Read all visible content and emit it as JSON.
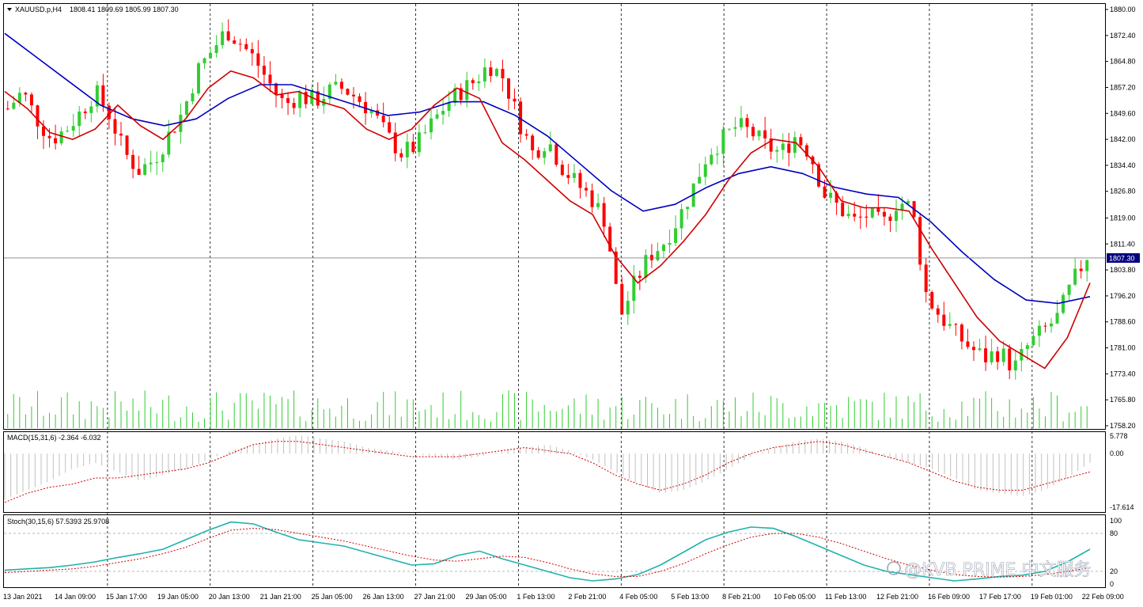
{
  "window": {
    "symbol_title": "XAUUSD.p,H4",
    "ohlc_text": "1808.41 1809.69 1805.99 1807.30",
    "macd_title": "MACD(15,31,6) -2.364 -6.032",
    "stoch_title": "Stoch(30,15,6) 57.5393 25.9708",
    "watermark": "@KVB PRIME 中文服务",
    "current_price_label": "1807.30",
    "menu_icon": "triangle-down-icon",
    "watermark_icon": "weibo-style-logo-icon"
  },
  "colors": {
    "bull": "#32cd32",
    "bear": "#ff0000",
    "ma_fast": "#d00000",
    "ma_slow": "#0000c0",
    "stoch_main": "#20b2aa",
    "signal": "#d00000",
    "grid": "#000000",
    "hist": "#c0c0c0"
  },
  "chart_data": [
    {
      "type": "candlestick",
      "title": "XAUUSD.p,H4",
      "ylim": [
        1758.2,
        1880.0
      ],
      "yticks": [
        "1880.00",
        "1872.40",
        "1864.80",
        "1857.20",
        "1849.60",
        "1842.00",
        "1834.40",
        "1826.80",
        "1819.00",
        "1811.40",
        "1803.80",
        "1796.20",
        "1788.60",
        "1781.00",
        "1773.40",
        "1765.80",
        "1758.20"
      ],
      "xticks": [
        "13 Jan 2021",
        "14 Jan 09:00",
        "15 Jan 17:00",
        "19 Jan 05:00",
        "20 Jan 13:00",
        "21 Jan 21:00",
        "25 Jan 05:00",
        "26 Jan 13:00",
        "27 Jan 21:00",
        "29 Jan 05:00",
        "1 Feb 13:00",
        "2 Feb 21:00",
        "4 Feb 05:00",
        "5 Feb 13:00",
        "8 Feb 21:00",
        "10 Feb 05:00",
        "11 Feb 13:00",
        "12 Feb 21:00",
        "16 Feb 09:00",
        "17 Feb 17:00",
        "19 Feb 01:00",
        "22 Feb 09:00"
      ],
      "close_path": [
        1851,
        1856,
        1848,
        1842,
        1845,
        1850,
        1856,
        1849,
        1838,
        1833,
        1836,
        1843,
        1850,
        1862,
        1868,
        1874,
        1870,
        1865,
        1858,
        1852,
        1855,
        1853,
        1856,
        1857,
        1854,
        1850,
        1843,
        1838,
        1840,
        1846,
        1852,
        1856,
        1859,
        1864,
        1860,
        1848,
        1838,
        1842,
        1834,
        1829,
        1825,
        1818,
        1790,
        1800,
        1808,
        1812,
        1819,
        1828,
        1838,
        1842,
        1846,
        1844,
        1840,
        1838,
        1843,
        1838,
        1826,
        1822,
        1818,
        1820,
        1817,
        1824,
        1822,
        1796,
        1790,
        1785,
        1781,
        1778,
        1780,
        1775,
        1782,
        1786,
        1790,
        1800,
        1808
      ],
      "last_price": 1807.3,
      "series": [
        {
          "name": "Moving Average (fast)",
          "values": [
            1856,
            1851,
            1844,
            1842,
            1845,
            1852,
            1846,
            1842,
            1848,
            1857,
            1862,
            1860,
            1855,
            1856,
            1853,
            1851,
            1845,
            1842,
            1845,
            1852,
            1857,
            1854,
            1841,
            1836,
            1830,
            1824,
            1820,
            1808,
            1800,
            1805,
            1812,
            1820,
            1830,
            1838,
            1842,
            1841,
            1834,
            1824,
            1822,
            1822,
            1821,
            1810,
            1800,
            1790,
            1783,
            1779,
            1775,
            1784,
            1800
          ]
        },
        {
          "name": "Moving Average (slow)",
          "values": [
            1873,
            1866,
            1859,
            1852,
            1848,
            1846,
            1848,
            1854,
            1858,
            1858,
            1855,
            1852,
            1849,
            1850,
            1853,
            1853,
            1849,
            1843,
            1835,
            1827,
            1821,
            1823,
            1828,
            1832,
            1834,
            1832,
            1828,
            1826,
            1825,
            1818,
            1809,
            1801,
            1795,
            1794,
            1796
          ]
        }
      ],
      "has_volume_histogram": true,
      "current_price_line": true
    },
    {
      "type": "macd",
      "title": "MACD(15,31,6)",
      "ylim": [
        -17.614,
        5.778
      ],
      "yticks": [
        "5.778",
        "0.00",
        "-17.614"
      ],
      "macd_value": -2.364,
      "signal_value": -6.032,
      "histogram": [
        -15,
        -12,
        -9,
        -5,
        -3,
        -6,
        -9,
        -7,
        -5,
        -2,
        1,
        3,
        5,
        6,
        5,
        4,
        2,
        1,
        0,
        -1,
        -2,
        -1,
        1,
        2,
        3,
        1,
        -2,
        -6,
        -10,
        -13,
        -12,
        -9,
        -5,
        -1,
        2,
        4,
        5,
        4,
        2,
        -1,
        -3,
        -5,
        -8,
        -12,
        -13,
        -14,
        -12,
        -8,
        -3
      ],
      "signal": [
        -16,
        -13,
        -11,
        -10,
        -8,
        -8,
        -7,
        -6,
        -5,
        -3,
        0,
        3,
        4,
        4,
        3,
        2,
        1,
        0,
        -1,
        -1,
        -1,
        0,
        1,
        2,
        1,
        0,
        -3,
        -7,
        -10,
        -12,
        -10,
        -7,
        -3,
        0,
        2,
        3,
        4,
        3,
        1,
        -1,
        -3,
        -6,
        -9,
        -11,
        -12,
        -12,
        -10,
        -8,
        -6
      ]
    },
    {
      "type": "stochastic",
      "title": "Stoch(30,15,6)",
      "ylim": [
        0,
        100
      ],
      "yticks": [
        "100",
        "80",
        "20",
        "0"
      ],
      "levels": [
        80,
        20
      ],
      "main_value": 57.5393,
      "signal_value": 25.9708,
      "main": [
        22,
        24,
        26,
        30,
        35,
        42,
        48,
        55,
        70,
        85,
        98,
        95,
        82,
        70,
        65,
        60,
        50,
        40,
        30,
        32,
        45,
        52,
        40,
        30,
        20,
        10,
        5,
        8,
        15,
        30,
        50,
        70,
        82,
        90,
        88,
        75,
        60,
        45,
        30,
        20,
        15,
        10,
        5,
        8,
        12,
        14,
        20,
        35,
        55
      ],
      "signal": [
        18,
        20,
        22,
        24,
        28,
        34,
        40,
        48,
        58,
        72,
        85,
        88,
        86,
        80,
        74,
        68,
        60,
        52,
        44,
        38,
        36,
        40,
        44,
        42,
        34,
        24,
        16,
        12,
        12,
        20,
        32,
        48,
        62,
        74,
        80,
        80,
        74,
        64,
        52,
        40,
        30,
        22,
        15,
        12,
        11,
        12,
        15,
        20,
        26
      ]
    }
  ]
}
